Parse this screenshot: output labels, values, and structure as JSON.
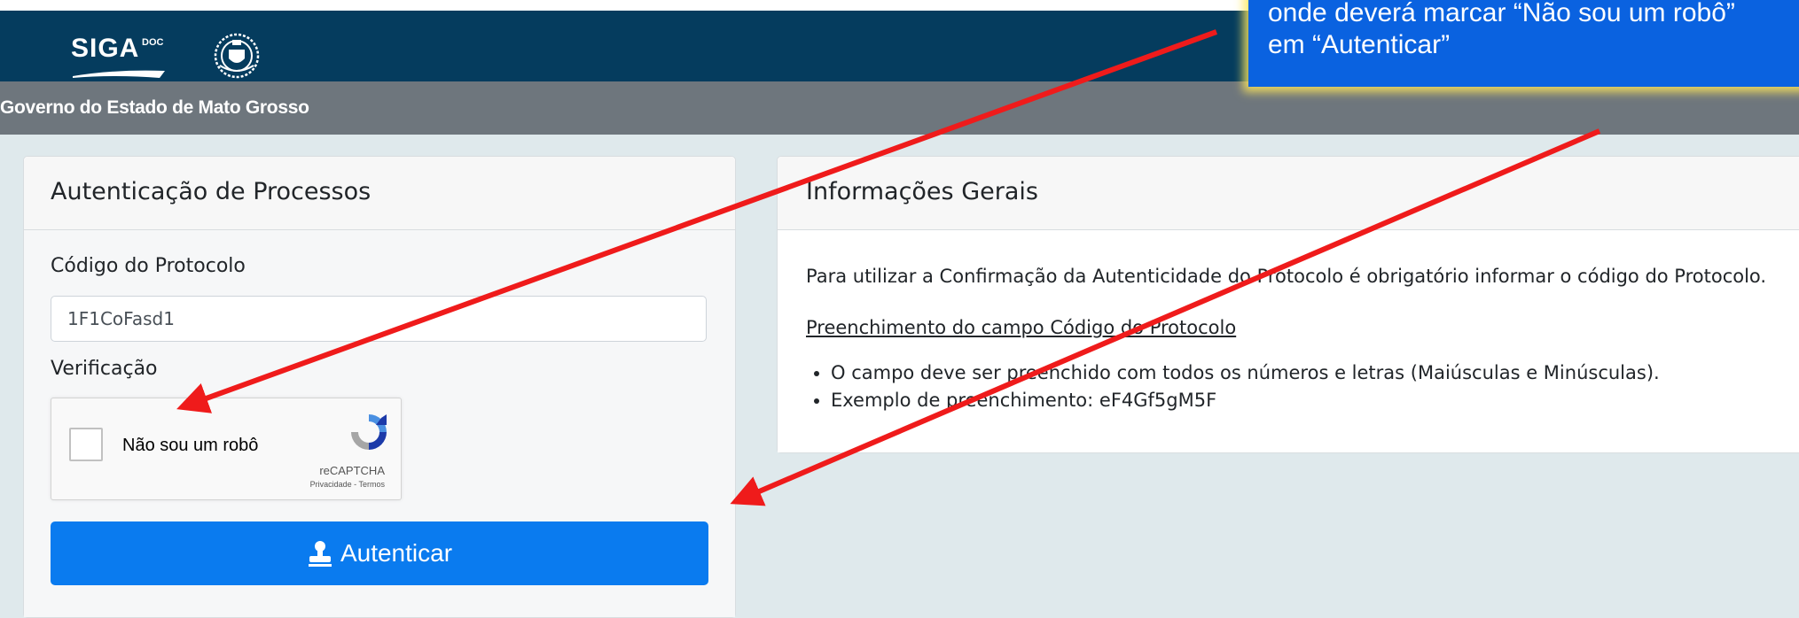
{
  "header": {
    "logo_text": "SIGA",
    "logo_sup": "DOC",
    "government": "Governo do Estado de Mato Grosso"
  },
  "auth_card": {
    "title": "Autenticação de Processos",
    "code_label": "Código do Protocolo",
    "code_value": "1F1CoFasd1",
    "verification_label": "Verificação",
    "captcha": {
      "checkbox_label": "Não sou um robô",
      "brand": "reCAPTCHA",
      "links": "Privacidade - Termos"
    },
    "submit_label": "Autenticar"
  },
  "info_card": {
    "title": "Informações Gerais",
    "paragraph": "Para utilizar a Confirmação da Autenticidade do Protocolo é obrigatório informar o código do Protocolo.",
    "subheading": "Preenchimento do campo Código do Protocolo",
    "bullets": [
      "O campo deve ser preenchido com todos os números e letras (Maiúsculas e Minúsculas).",
      "Exemplo de preenchimento: eF4Gf5gM5F"
    ]
  },
  "annotation": {
    "line1": "onde deverá  marcar “Não sou um robô”",
    "line2": "em “Autenticar”"
  },
  "colors": {
    "topbar": "#053c5e",
    "govbar": "#6e767d",
    "button": "#0a7bef",
    "callout": "#0a62e0",
    "arrow": "#ef1b1b"
  }
}
